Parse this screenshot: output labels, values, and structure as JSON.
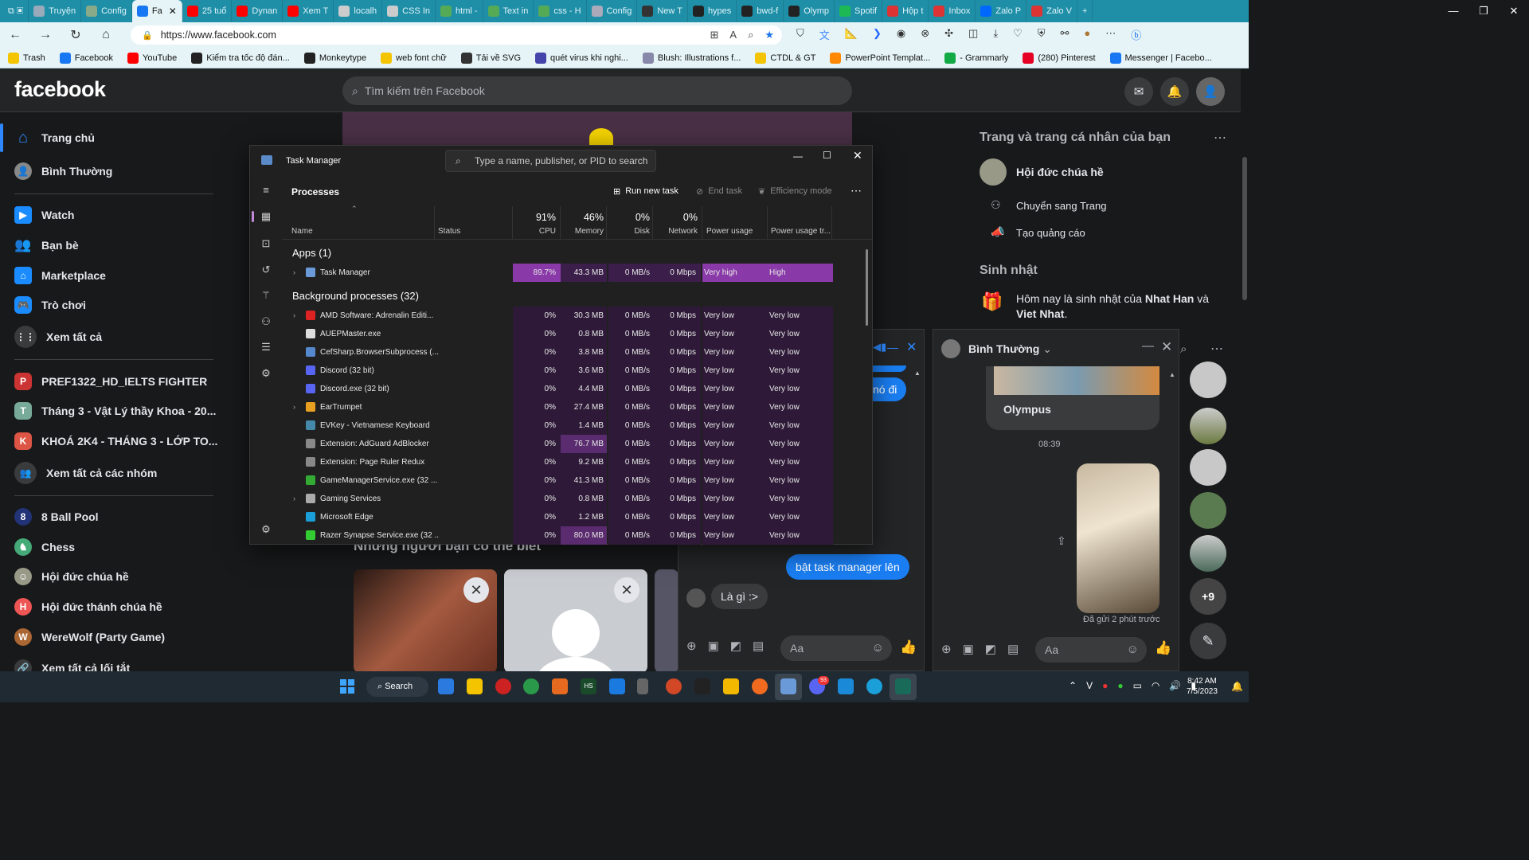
{
  "browser": {
    "tabs": [
      {
        "label": "Truyện",
        "color": "#9ab"
      },
      {
        "label": "Config",
        "color": "#8a8"
      },
      {
        "label": "Fa",
        "color": "#1877f2",
        "active": true
      },
      {
        "label": "25 tuổ",
        "color": "#f00"
      },
      {
        "label": "Dynan",
        "color": "#f00"
      },
      {
        "label": "Xem T",
        "color": "#f00"
      },
      {
        "label": "localh",
        "color": "#ccc"
      },
      {
        "label": "CSS In",
        "color": "#ccc"
      },
      {
        "label": "html -",
        "color": "#5a5"
      },
      {
        "label": "Text in",
        "color": "#5a5"
      },
      {
        "label": "css - H",
        "color": "#5a5"
      },
      {
        "label": "Config",
        "color": "#aab"
      },
      {
        "label": "New T",
        "color": "#333"
      },
      {
        "label": "hypes",
        "color": "#222"
      },
      {
        "label": "bwd-f",
        "color": "#222"
      },
      {
        "label": "Olymp",
        "color": "#222"
      },
      {
        "label": "Spotif",
        "color": "#1db954"
      },
      {
        "label": "Hộp t",
        "color": "#d33"
      },
      {
        "label": "Inbox",
        "color": "#d33"
      },
      {
        "label": "Zalo P",
        "color": "#0068ff"
      },
      {
        "label": "Zalo V",
        "color": "#d33"
      }
    ],
    "url": "https://www.facebook.com",
    "bookmarks": [
      "Trash",
      "Facebook",
      "YouTube",
      "Kiểm tra tốc độ đán...",
      "Monkeytype",
      "web font chữ",
      "Tải về SVG",
      "quét virus khi nghi...",
      "Blush: Illustrations f...",
      "CTDL & GT",
      "PowerPoint Templat...",
      "- Grammarly",
      "(280) Pinterest",
      "Messenger | Facebo..."
    ]
  },
  "facebook": {
    "logo": "facebook",
    "search_placeholder": "Tìm kiếm trên Facebook",
    "nav": [
      "Trang chủ",
      "Bình Thường",
      "Watch",
      "Bạn bè",
      "Marketplace",
      "Trò chơi",
      "Xem tất cả",
      "PREF1322_HD_IELTS FIGHTER",
      "Tháng 3 - Vật Lý thầy Khoa - 20...",
      "KHOÁ 2K4 - THÁNG 3 - LỚP TO...",
      "Xem tất cả các nhóm",
      "8 Ball Pool",
      "Chess",
      "Hội đức chúa hề",
      "Hội đức thánh chúa hề",
      "WereWolf (Party Game)",
      "Xem tất cả lối tắt"
    ],
    "friends_title": "Những người bạn có thể biết",
    "right": {
      "pages_title": "Trang và trang cá nhân của bạn",
      "page_name": "Hội đức chúa hề",
      "switch": "Chuyển sang Trang",
      "ads": "Tạo quảng cáo",
      "birthday_title": "Sinh nhật",
      "birthday_text_pre": "Hôm nay là sinh nhật của ",
      "birthday_name1": "Nhat Han",
      "birthday_and": " và ",
      "birthday_name2": "Viet Nhat",
      "birthday_end": "."
    },
    "chat1": {
      "msg_partial": "nó đi",
      "sent": "bật task manager lên",
      "received": "Là gì :>",
      "input_placeholder": "Aa"
    },
    "chat2": {
      "name": "Bình Thường",
      "card_title": "Olympus",
      "time": "08:39",
      "sent_status": "Đã gửi 2 phút trước",
      "input_placeholder": "Aa",
      "badge": "+9"
    }
  },
  "task_manager": {
    "title": "Task Manager",
    "search_placeholder": "Type a name, publisher, or PID to search",
    "section": "Processes",
    "run_new_task": "Run new task",
    "end_task": "End task",
    "efficiency": "Efficiency mode",
    "columns": {
      "name": "Name",
      "status": "Status",
      "cpu_pct": "91%",
      "cpu": "CPU",
      "mem_pct": "46%",
      "mem": "Memory",
      "disk_pct": "0%",
      "disk": "Disk",
      "net_pct": "0%",
      "net": "Network",
      "power": "Power usage",
      "power_trend": "Power usage tr..."
    },
    "apps_header": "Apps (1)",
    "bg_header": "Background processes (32)",
    "apps": [
      {
        "name": "Task Manager",
        "cpu": "89.7%",
        "mem": "43.3 MB",
        "disk": "0 MB/s",
        "net": "0 Mbps",
        "power": "Very high",
        "trend": "High",
        "expand": true,
        "icon": "#6a9bd8"
      }
    ],
    "bg": [
      {
        "name": "AMD Software: Adrenalin Editi...",
        "cpu": "0%",
        "mem": "30.3 MB",
        "disk": "0 MB/s",
        "net": "0 Mbps",
        "power": "Very low",
        "trend": "Very low",
        "expand": true,
        "icon": "#d22"
      },
      {
        "name": "AUEPMaster.exe",
        "cpu": "0%",
        "mem": "0.8 MB",
        "disk": "0 MB/s",
        "net": "0 Mbps",
        "power": "Very low",
        "trend": "Very low",
        "icon": "#ddd"
      },
      {
        "name": "CefSharp.BrowserSubprocess (...",
        "cpu": "0%",
        "mem": "3.8 MB",
        "disk": "0 MB/s",
        "net": "0 Mbps",
        "power": "Very low",
        "trend": "Very low",
        "icon": "#58c"
      },
      {
        "name": "Discord (32 bit)",
        "cpu": "0%",
        "mem": "3.6 MB",
        "disk": "0 MB/s",
        "net": "0 Mbps",
        "power": "Very low",
        "trend": "Very low",
        "icon": "#5865f2"
      },
      {
        "name": "Discord.exe (32 bit)",
        "cpu": "0%",
        "mem": "4.4 MB",
        "disk": "0 MB/s",
        "net": "0 Mbps",
        "power": "Very low",
        "trend": "Very low",
        "icon": "#5865f2"
      },
      {
        "name": "EarTrumpet",
        "cpu": "0%",
        "mem": "27.4 MB",
        "disk": "0 MB/s",
        "net": "0 Mbps",
        "power": "Very low",
        "trend": "Very low",
        "expand": true,
        "icon": "#e8a020"
      },
      {
        "name": "EVKey - Vietnamese Keyboard",
        "cpu": "0%",
        "mem": "1.4 MB",
        "disk": "0 MB/s",
        "net": "0 Mbps",
        "power": "Very low",
        "trend": "Very low",
        "icon": "#48a"
      },
      {
        "name": "Extension: AdGuard AdBlocker",
        "cpu": "0%",
        "mem": "76.7 MB",
        "disk": "0 MB/s",
        "net": "0 Mbps",
        "power": "Very low",
        "trend": "Very low",
        "icon": "#888",
        "memhi": true
      },
      {
        "name": "Extension: Page Ruler Redux",
        "cpu": "0%",
        "mem": "9.2 MB",
        "disk": "0 MB/s",
        "net": "0 Mbps",
        "power": "Very low",
        "trend": "Very low",
        "icon": "#888"
      },
      {
        "name": "GameManagerService.exe (32 ...",
        "cpu": "0%",
        "mem": "41.3 MB",
        "disk": "0 MB/s",
        "net": "0 Mbps",
        "power": "Very low",
        "trend": "Very low",
        "icon": "#3a3"
      },
      {
        "name": "Gaming Services",
        "cpu": "0%",
        "mem": "0.8 MB",
        "disk": "0 MB/s",
        "net": "0 Mbps",
        "power": "Very low",
        "trend": "Very low",
        "expand": true,
        "icon": "#aaa"
      },
      {
        "name": "Microsoft Edge",
        "cpu": "0%",
        "mem": "1.2 MB",
        "disk": "0 MB/s",
        "net": "0 Mbps",
        "power": "Very low",
        "trend": "Very low",
        "icon": "#1a9fd8"
      },
      {
        "name": "Razer Synapse Service.exe (32 ...",
        "cpu": "0%",
        "mem": "80.0 MB",
        "disk": "0 MB/s",
        "net": "0 Mbps",
        "power": "Very low",
        "trend": "Very low",
        "icon": "#3c3",
        "memhi": true
      }
    ]
  },
  "taskbar": {
    "search": "Search",
    "time": "8:42 AM",
    "date": "7/5/2023",
    "discord_badge": "93"
  }
}
